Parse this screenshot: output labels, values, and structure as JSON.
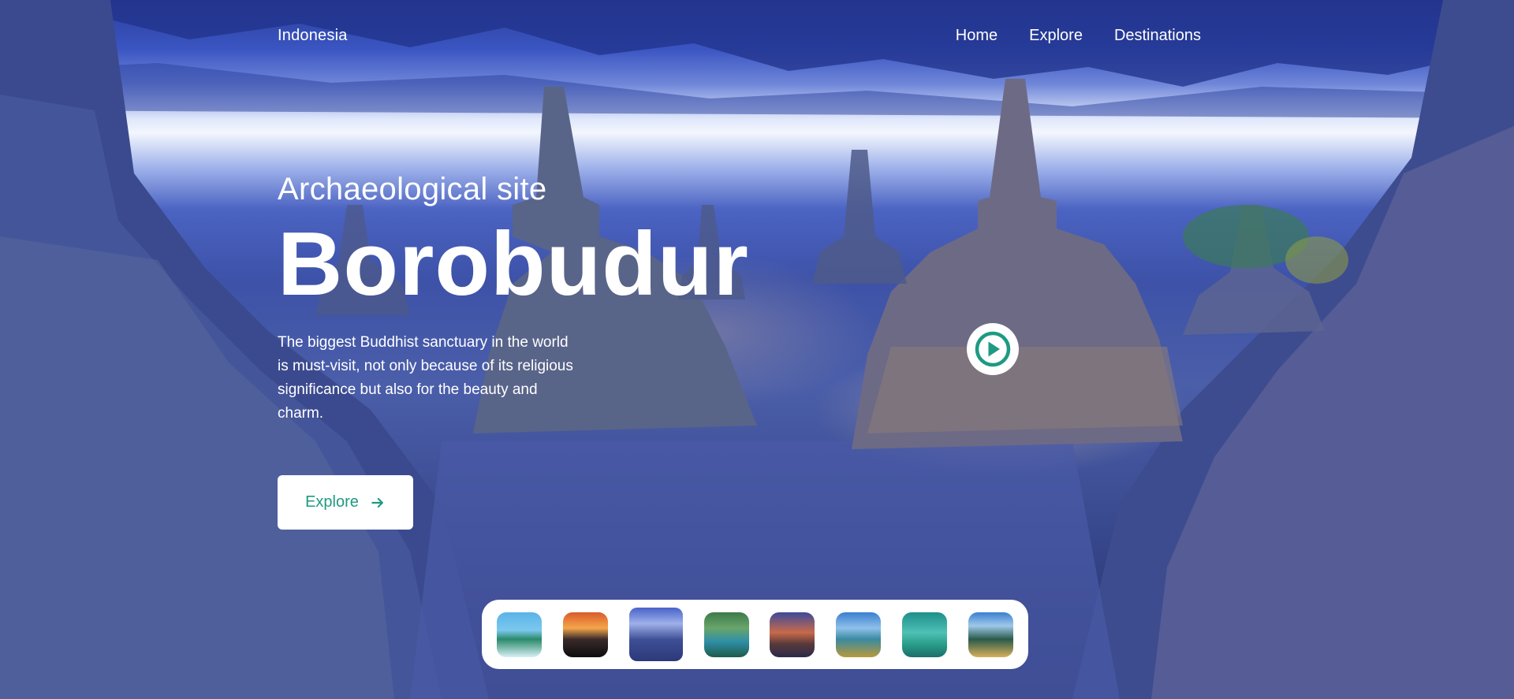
{
  "nav": {
    "brand": "Indonesia",
    "links": [
      "Home",
      "Explore",
      "Destinations"
    ]
  },
  "hero": {
    "subtitle": "Archaeological site",
    "title": "Borobudur",
    "description": "The biggest Buddhist sanctuary in the world is must-visit, not only because of its religious significance but also for the beauty and charm.",
    "explore_label": "Explore",
    "explore_icon": "arrow-right-icon",
    "play_icon": "play-icon"
  },
  "gallery": {
    "selected_index": 2,
    "thumbnails": [
      "beach-thumbnail",
      "sunset-thumbnail",
      "borobudur-thumbnail",
      "lake-thumbnail",
      "mountain-thumbnail",
      "bay-thumbnail",
      "reef-thumbnail",
      "island-thumbnail"
    ]
  },
  "colors": {
    "accent": "#1e9a82",
    "text": "#ffffff"
  }
}
